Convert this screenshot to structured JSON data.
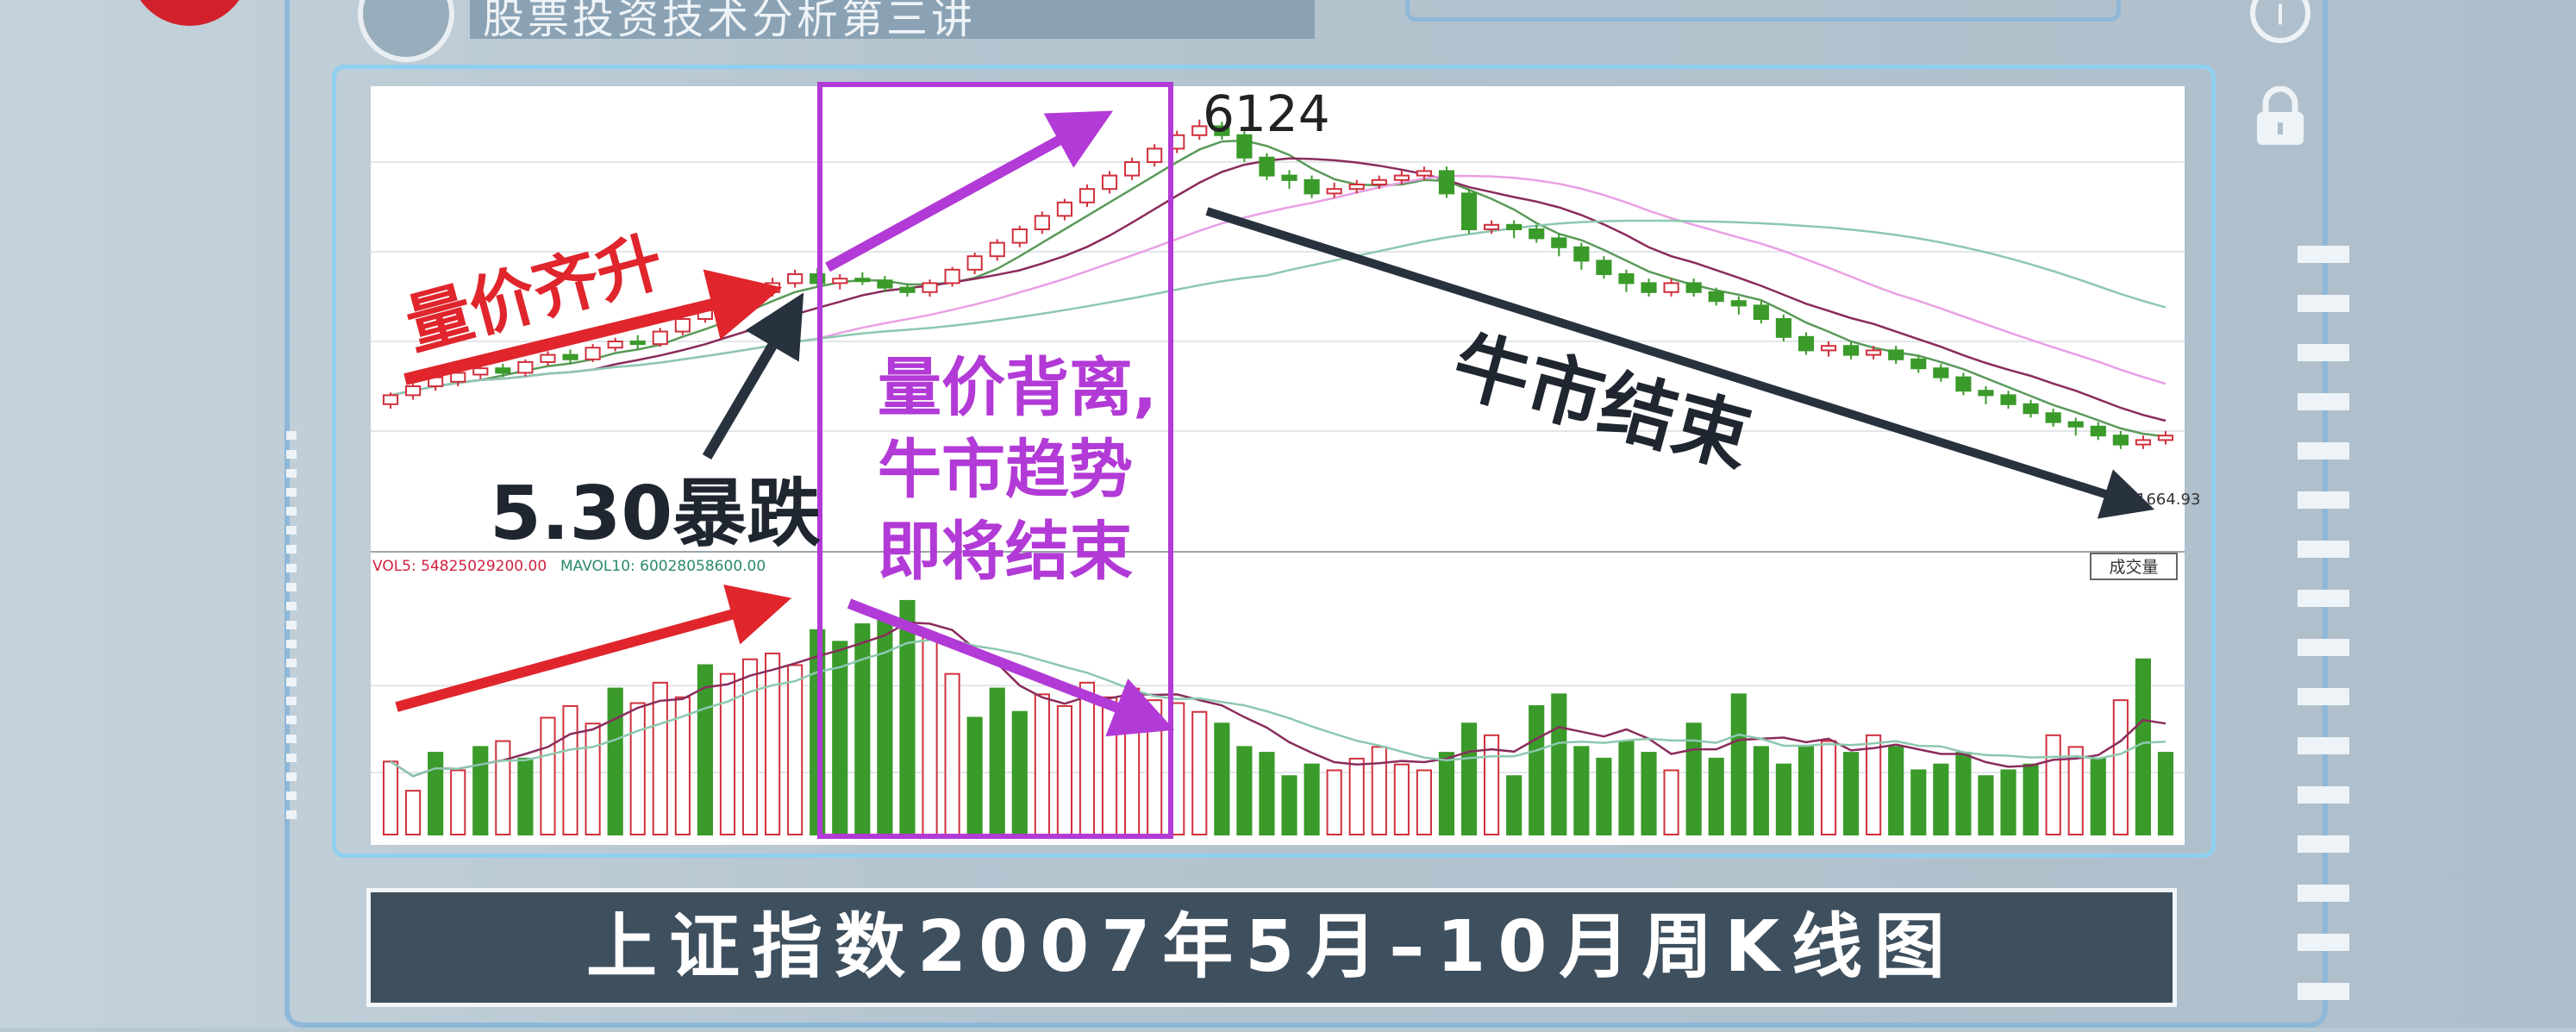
{
  "header": {
    "title": "股票投资技术分析第三讲",
    "info_icon": "info-icon",
    "lock_icon": "lock-icon"
  },
  "colors": {
    "up_candle": "#d0303c",
    "down_candle": "#3a9a2a",
    "purple_box": "#b23ad6",
    "red_arrow": "#e0252c",
    "dark_arrow": "#28323e",
    "ma5": "#5a9a5a",
    "ma10": "#8a2c5c",
    "ma20": "#e9a0e4",
    "ma60": "#8cc8b0"
  },
  "annotations": {
    "peak_label": "6124",
    "rise_label": "量价齐升",
    "crash_label": "5.30暴跌",
    "divergence_line1": "量价背离,",
    "divergence_line2": "牛市趋势",
    "divergence_line3": "即将结束",
    "bull_end_label": "牛市结束",
    "last_price": "1664.93",
    "volume_button": "成交量",
    "vol_ma5_label": "VOL5: 54825029200.00",
    "vol_ma10_label": "MAVOL10: 60028058600.00"
  },
  "caption": "上证指数2007年5月–10月周K线图",
  "chart_data": {
    "type": "candlestick",
    "title": "上证指数2007年5月–10月周K线图",
    "peak_value": 6124,
    "last_value": 1664.93,
    "ylim": [
      1400,
      6400
    ],
    "candles": [
      [
        2950,
        3050,
        2900,
        3080
      ],
      [
        3050,
        3150,
        3000,
        3180
      ],
      [
        3150,
        3250,
        3100,
        3280
      ],
      [
        3200,
        3300,
        3150,
        3330
      ],
      [
        3280,
        3350,
        3230,
        3380
      ],
      [
        3350,
        3300,
        3250,
        3400
      ],
      [
        3300,
        3420,
        3260,
        3450
      ],
      [
        3420,
        3500,
        3380,
        3540
      ],
      [
        3500,
        3450,
        3400,
        3560
      ],
      [
        3450,
        3580,
        3420,
        3620
      ],
      [
        3580,
        3650,
        3540,
        3690
      ],
      [
        3650,
        3620,
        3560,
        3720
      ],
      [
        3620,
        3760,
        3590,
        3800
      ],
      [
        3760,
        3900,
        3720,
        3950
      ],
      [
        3900,
        4000,
        3860,
        4060
      ],
      [
        4000,
        4100,
        3950,
        4150
      ],
      [
        4100,
        4200,
        4050,
        4260
      ],
      [
        4200,
        4300,
        4150,
        4360
      ],
      [
        4300,
        4400,
        4250,
        4450
      ],
      [
        4400,
        4300,
        4250,
        4470
      ],
      [
        4300,
        4350,
        4230,
        4400
      ],
      [
        4350,
        4330,
        4280,
        4420
      ],
      [
        4330,
        4250,
        4200,
        4380
      ],
      [
        4250,
        4200,
        4150,
        4300
      ],
      [
        4200,
        4300,
        4150,
        4340
      ],
      [
        4300,
        4450,
        4260,
        4480
      ],
      [
        4450,
        4600,
        4400,
        4640
      ],
      [
        4600,
        4750,
        4550,
        4790
      ],
      [
        4750,
        4900,
        4700,
        4940
      ],
      [
        4900,
        5050,
        4850,
        5100
      ],
      [
        5050,
        5200,
        5000,
        5240
      ],
      [
        5200,
        5350,
        5150,
        5400
      ],
      [
        5350,
        5500,
        5300,
        5550
      ],
      [
        5500,
        5650,
        5450,
        5700
      ],
      [
        5650,
        5800,
        5600,
        5850
      ],
      [
        5800,
        5950,
        5750,
        6000
      ],
      [
        5950,
        6050,
        5900,
        6124
      ],
      [
        6050,
        5950,
        5900,
        6100
      ],
      [
        5950,
        5700,
        5650,
        6000
      ],
      [
        5700,
        5500,
        5450,
        5750
      ],
      [
        5500,
        5450,
        5350,
        5560
      ],
      [
        5450,
        5300,
        5250,
        5500
      ],
      [
        5300,
        5350,
        5250,
        5420
      ],
      [
        5350,
        5400,
        5300,
        5450
      ],
      [
        5400,
        5450,
        5350,
        5500
      ],
      [
        5450,
        5500,
        5400,
        5560
      ],
      [
        5500,
        5550,
        5450,
        5600
      ],
      [
        5550,
        5300,
        5250,
        5600
      ],
      [
        5300,
        4900,
        4850,
        5350
      ],
      [
        4900,
        4950,
        4850,
        5000
      ],
      [
        4950,
        4900,
        4800,
        5000
      ],
      [
        4900,
        4800,
        4750,
        4950
      ],
      [
        4800,
        4700,
        4600,
        4850
      ],
      [
        4700,
        4550,
        4450,
        4750
      ],
      [
        4550,
        4400,
        4350,
        4600
      ],
      [
        4400,
        4300,
        4200,
        4450
      ],
      [
        4300,
        4200,
        4150,
        4350
      ],
      [
        4200,
        4300,
        4150,
        4350
      ],
      [
        4300,
        4200,
        4150,
        4350
      ],
      [
        4200,
        4100,
        4050,
        4250
      ],
      [
        4100,
        4050,
        3950,
        4150
      ],
      [
        4050,
        3900,
        3850,
        4100
      ],
      [
        3900,
        3700,
        3650,
        3950
      ],
      [
        3700,
        3550,
        3500,
        3750
      ],
      [
        3550,
        3600,
        3480,
        3650
      ],
      [
        3600,
        3500,
        3450,
        3650
      ],
      [
        3500,
        3550,
        3450,
        3600
      ],
      [
        3550,
        3450,
        3400,
        3600
      ],
      [
        3450,
        3350,
        3300,
        3500
      ],
      [
        3350,
        3250,
        3200,
        3400
      ],
      [
        3250,
        3100,
        3050,
        3300
      ],
      [
        3100,
        3050,
        2950,
        3150
      ],
      [
        3050,
        2950,
        2900,
        3100
      ],
      [
        2950,
        2850,
        2800,
        3000
      ],
      [
        2850,
        2750,
        2700,
        2900
      ],
      [
        2750,
        2700,
        2600,
        2800
      ],
      [
        2700,
        2600,
        2550,
        2750
      ],
      [
        2600,
        2500,
        2450,
        2650
      ],
      [
        2500,
        2550,
        2450,
        2600
      ],
      [
        2550,
        2600,
        2500,
        2650
      ]
    ],
    "volume": [
      25,
      15,
      28,
      22,
      30,
      32,
      26,
      40,
      44,
      38,
      50,
      45,
      52,
      47,
      58,
      55,
      60,
      62,
      58,
      70,
      66,
      72,
      75,
      80,
      68,
      55,
      40,
      50,
      42,
      48,
      44,
      52,
      47,
      50,
      46,
      45,
      42,
      38,
      30,
      28,
      20,
      24,
      22,
      26,
      30,
      24,
      22,
      28,
      38,
      34,
      20,
      44,
      48,
      30,
      26,
      32,
      28,
      22,
      38,
      26,
      48,
      30,
      24,
      30,
      32,
      28,
      34,
      30,
      22,
      24,
      28,
      20,
      22,
      24,
      34,
      30,
      26,
      46,
      60,
      28
    ],
    "vol_up": [
      1,
      1,
      0,
      1,
      0,
      1,
      0,
      1,
      1,
      1,
      0,
      1,
      1,
      1,
      0,
      1,
      1,
      1,
      1,
      0,
      0,
      0,
      0,
      0,
      1,
      1,
      0,
      0,
      0,
      1,
      1,
      1,
      1,
      1,
      1,
      1,
      1,
      0,
      0,
      0,
      0,
      0,
      1,
      1,
      1,
      1,
      1,
      0,
      0,
      1,
      0,
      0,
      0,
      0,
      0,
      0,
      0,
      1,
      0,
      0,
      0,
      0,
      0,
      0,
      1,
      0,
      1,
      0,
      0,
      0,
      0,
      0,
      0,
      0,
      1,
      1,
      0,
      1,
      0,
      0
    ]
  }
}
